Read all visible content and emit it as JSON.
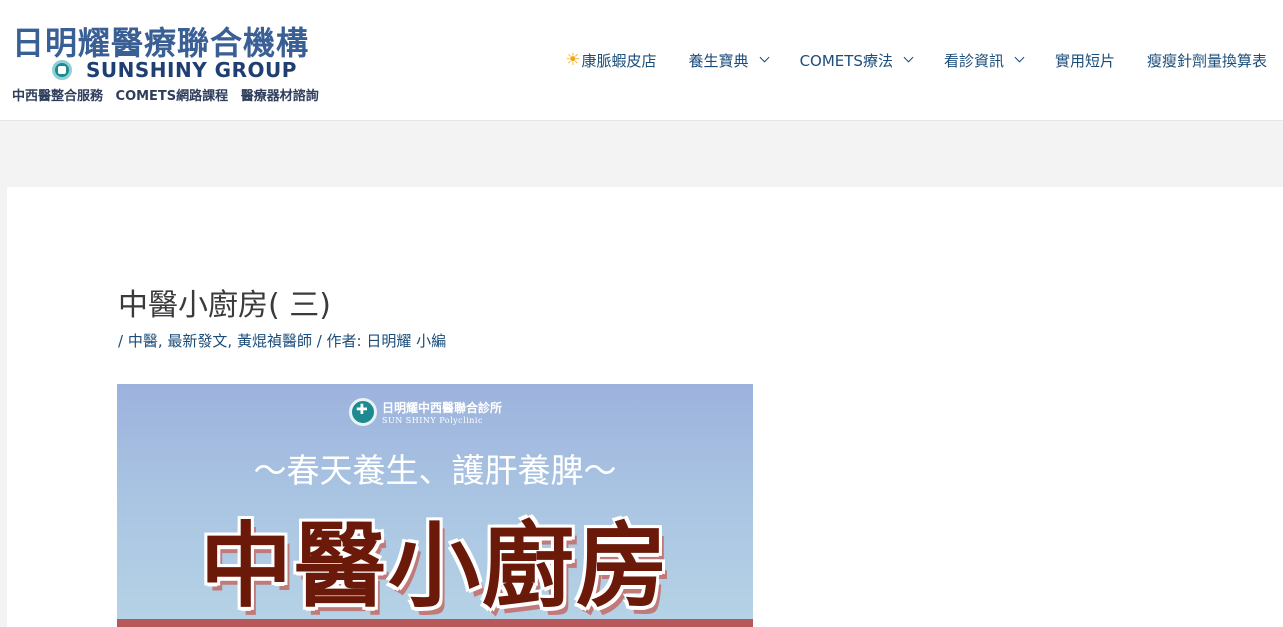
{
  "header": {
    "logo": {
      "title": "日明耀醫療聯合機構",
      "group": "SUNSHINY GROUP",
      "services": "中西醫整合服務 COMETS網路課程 醫療器材諮詢"
    },
    "nav": [
      {
        "label": "康脈蝦皮店",
        "icon": "sun-icon",
        "has_dropdown": false
      },
      {
        "label": "養生寶典",
        "has_dropdown": true
      },
      {
        "label": "COMETS療法",
        "has_dropdown": true
      },
      {
        "label": "看診資訊",
        "has_dropdown": true
      },
      {
        "label": "實用短片",
        "has_dropdown": false
      },
      {
        "label": "瘦瘦針劑量換算表",
        "has_dropdown": false
      }
    ]
  },
  "post": {
    "title": "中醫小廚房( 三)",
    "meta": {
      "prefix": "/ ",
      "categories": [
        "中醫",
        "最新發文",
        "黃焜禎醫師"
      ],
      "author_prefix": " / 作者: ",
      "author": "日明耀 小編"
    },
    "featured_image": {
      "clinic_name": "日明耀中西醫聯合診所",
      "clinic_en": "SUN SHINY Polyclinic",
      "subtitle": "～春天養生、護肝養脾～",
      "headline": "中醫小廚房"
    }
  },
  "colors": {
    "link": "#1b4d7a",
    "logo_blue": "#3a5f95",
    "headline": "#6b1a0a",
    "page_bg": "#f3f3f3"
  }
}
